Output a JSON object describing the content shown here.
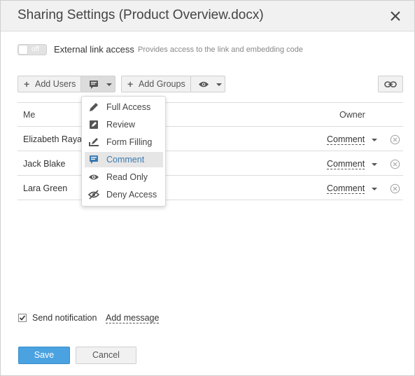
{
  "dialog": {
    "title": "Sharing Settings (Product Overview.docx)"
  },
  "external_link": {
    "toggle_state": "off",
    "label": "External link access",
    "description": "Provides access to the link and embedding code"
  },
  "toolbar": {
    "add_users_label": "Add Users",
    "add_groups_label": "Add Groups",
    "users_access_icon": "comment-icon",
    "groups_access_icon": "eye-icon",
    "link_icon": "link-icon"
  },
  "table": {
    "owner_name": "Me",
    "owner_role": "Owner",
    "rows": [
      {
        "name": "Elizabeth Raya",
        "access": "Comment"
      },
      {
        "name": "Jack Blake",
        "access": "Comment"
      },
      {
        "name": "Lara Green",
        "access": "Comment"
      }
    ]
  },
  "access_menu": {
    "selected": "Comment",
    "items": [
      {
        "label": "Full Access",
        "icon": "pencil-icon"
      },
      {
        "label": "Review",
        "icon": "review-icon"
      },
      {
        "label": "Form Filling",
        "icon": "form-filling-icon"
      },
      {
        "label": "Comment",
        "icon": "comment-icon"
      },
      {
        "label": "Read Only",
        "icon": "eye-icon"
      },
      {
        "label": "Deny Access",
        "icon": "eye-slash-icon"
      }
    ]
  },
  "notification": {
    "checked": true,
    "label": "Send notification",
    "add_message_label": "Add message"
  },
  "footer": {
    "save_label": "Save",
    "cancel_label": "Cancel"
  },
  "colors": {
    "accent": "#4aa2e0",
    "selected_text": "#3a7ab0",
    "header_bg": "#f1f1f1"
  }
}
